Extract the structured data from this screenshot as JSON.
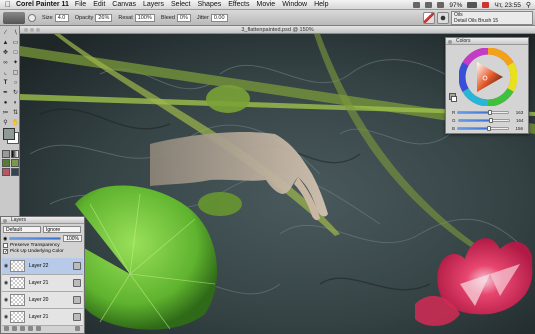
{
  "menubar": {
    "apple": "",
    "app": "Corel Painter 11",
    "items": [
      "File",
      "Edit",
      "Canvas",
      "Layers",
      "Select",
      "Shapes",
      "Effects",
      "Movie",
      "Window",
      "Help"
    ],
    "battery": "97%",
    "clock": "Чт, 23:55"
  },
  "propbar": {
    "size_label": "Size",
    "size_value": "4.0",
    "opacity_label": "Opacity",
    "opacity_value": "26%",
    "resat_label": "Resat",
    "resat_value": "100%",
    "bleed_label": "Bleed",
    "bleed_value": "0%",
    "jitter_label": "Jitter",
    "jitter_value": "0.00",
    "brush_category": "Oils",
    "brush_variant": "Detail Oils Brush 15"
  },
  "document": {
    "title": "3_flattenpainted.psd @ 150%"
  },
  "colors_panel": {
    "title": "Colors",
    "r_label": "R",
    "r_value": "163",
    "r_fraction": 0.64,
    "g_label": "G",
    "g_value": "164",
    "g_fraction": 0.64,
    "b_label": "B",
    "b_value": "156",
    "b_fraction": 0.61,
    "current_color": "#a3a49c"
  },
  "layers_panel": {
    "title": "Layers",
    "composite_method": "Default",
    "composite_depth": "Ignore",
    "opacity": "100%",
    "opacity_fraction": 1.0,
    "preserve_transparency": "Preserve Transparency",
    "pick_up_underlying": "Pick Up Underlying Color",
    "layers": [
      {
        "name": "Layer 22",
        "selected": true
      },
      {
        "name": "Layer 21",
        "selected": false
      },
      {
        "name": "Layer 20",
        "selected": false
      },
      {
        "name": "Layer 21",
        "selected": false
      }
    ]
  },
  "colors": {
    "accent": "#3a6fd0",
    "water": "#3b4a4c",
    "lily_pad": "#6ec23a",
    "flower": "#e0285a"
  }
}
